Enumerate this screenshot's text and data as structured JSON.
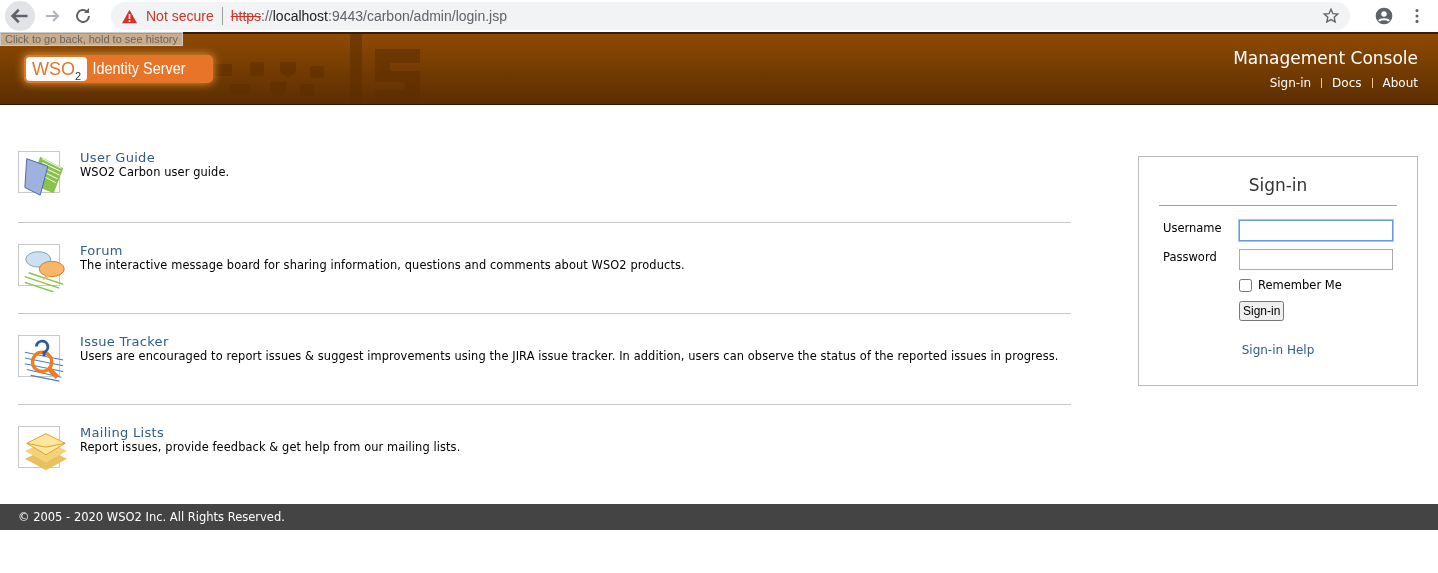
{
  "browser": {
    "security": "Not secure",
    "url_scheme": "https",
    "url_separator": "://",
    "url_host": "localhost",
    "url_path": ":9443/carbon/admin/login.jsp",
    "tooltip": "Click to go back, hold to see history"
  },
  "header": {
    "logo_mark": "WSO",
    "logo_sub": "2",
    "product": "Identity Server",
    "title": "Management Console",
    "links": [
      "Sign-in",
      "Docs",
      "About"
    ]
  },
  "resources": [
    {
      "kind": "guide",
      "title": "User Guide",
      "description": "WSO2 Carbon user guide."
    },
    {
      "kind": "forum",
      "title": "Forum",
      "description": "The interactive message board for sharing information, questions and comments about WSO2 products."
    },
    {
      "kind": "tracker",
      "title": "Issue Tracker",
      "description": "Users are encouraged to report issues & suggest improvements using the JIRA issue tracker. In addition, users can observe the status of the reported issues in progress."
    },
    {
      "kind": "mail",
      "title": "Mailing Lists",
      "description": "Report issues, provide feedback & get help from our mailing lists."
    }
  ],
  "signin": {
    "title": "Sign-in",
    "username_label": "Username",
    "password_label": "Password",
    "remember_label": "Remember Me",
    "remember_checked": false,
    "button": "Sign-in",
    "help": "Sign-in Help"
  },
  "footer": "© 2005 - 2020 WSO2 Inc. All Rights Reserved."
}
